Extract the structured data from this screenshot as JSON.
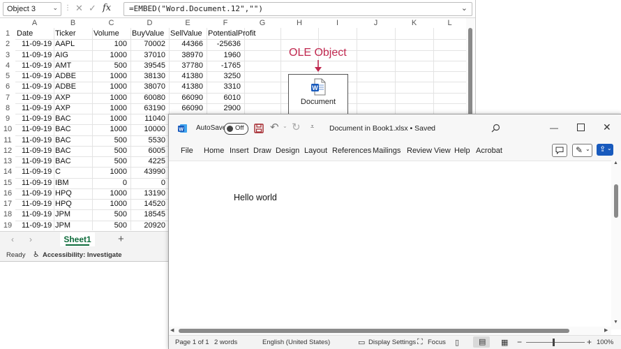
{
  "excel": {
    "name_box": "Object 3",
    "formula": "=EMBED(\"Word.Document.12\",\"\")",
    "columns": [
      "A",
      "B",
      "C",
      "D",
      "E",
      "F",
      "G",
      "H",
      "I",
      "J",
      "K",
      "L"
    ],
    "rows": [
      {
        "n": "1",
        "a": "Date",
        "b": "Ticker",
        "c": "Volume",
        "d": "BuyValue",
        "e": "SellValue",
        "f": "PotentialProfit",
        "header": true
      },
      {
        "n": "2",
        "a": "11-09-19",
        "b": "AAPL",
        "c": "100",
        "d": "70002",
        "e": "44366",
        "f": "-25636"
      },
      {
        "n": "3",
        "a": "11-09-19",
        "b": "AIG",
        "c": "1000",
        "d": "37010",
        "e": "38970",
        "f": "1960"
      },
      {
        "n": "4",
        "a": "11-09-19",
        "b": "AMT",
        "c": "500",
        "d": "39545",
        "e": "37780",
        "f": "-1765"
      },
      {
        "n": "5",
        "a": "11-09-19",
        "b": "ADBE",
        "c": "1000",
        "d": "38130",
        "e": "41380",
        "f": "3250"
      },
      {
        "n": "6",
        "a": "11-09-19",
        "b": "ADBE",
        "c": "1000",
        "d": "38070",
        "e": "41380",
        "f": "3310"
      },
      {
        "n": "7",
        "a": "11-09-19",
        "b": "AXP",
        "c": "1000",
        "d": "60080",
        "e": "66090",
        "f": "6010"
      },
      {
        "n": "8",
        "a": "11-09-19",
        "b": "AXP",
        "c": "1000",
        "d": "63190",
        "e": "66090",
        "f": "2900"
      },
      {
        "n": "9",
        "a": "11-09-19",
        "b": "BAC",
        "c": "1000",
        "d": "11040",
        "e": "",
        "f": ""
      },
      {
        "n": "10",
        "a": "11-09-19",
        "b": "BAC",
        "c": "1000",
        "d": "10000",
        "e": "",
        "f": ""
      },
      {
        "n": "11",
        "a": "11-09-19",
        "b": "BAC",
        "c": "500",
        "d": "5530",
        "e": "",
        "f": ""
      },
      {
        "n": "12",
        "a": "11-09-19",
        "b": "BAC",
        "c": "500",
        "d": "6005",
        "e": "",
        "f": ""
      },
      {
        "n": "13",
        "a": "11-09-19",
        "b": "BAC",
        "c": "500",
        "d": "4225",
        "e": "",
        "f": ""
      },
      {
        "n": "14",
        "a": "11-09-19",
        "b": "C",
        "c": "1000",
        "d": "43990",
        "e": "",
        "f": ""
      },
      {
        "n": "15",
        "a": "11-09-19",
        "b": "IBM",
        "c": "0",
        "d": "0",
        "e": "",
        "f": ""
      },
      {
        "n": "16",
        "a": "11-09-19",
        "b": "HPQ",
        "c": "1000",
        "d": "13190",
        "e": "",
        "f": ""
      },
      {
        "n": "17",
        "a": "11-09-19",
        "b": "HPQ",
        "c": "1000",
        "d": "14520",
        "e": "",
        "f": ""
      },
      {
        "n": "18",
        "a": "11-09-19",
        "b": "JPM",
        "c": "500",
        "d": "18545",
        "e": "",
        "f": ""
      },
      {
        "n": "19",
        "a": "11-09-19",
        "b": "JPM",
        "c": "500",
        "d": "20920",
        "e": "",
        "f": ""
      }
    ],
    "sheet_tab": "Sheet1",
    "status_ready": "Ready",
    "status_accessibility": "Accessibility: Investigate"
  },
  "ole": {
    "annotation": "OLE Object",
    "label": "Document",
    "accent": "#c0284f"
  },
  "word": {
    "autosave_label": "AutoSave",
    "autosave_state": "Off",
    "title": "Document in Book1.xlsx • Saved",
    "menu": [
      "File",
      "Home",
      "Insert",
      "Draw",
      "Design",
      "Layout",
      "References",
      "Mailings",
      "Review",
      "View",
      "Help",
      "Acrobat"
    ],
    "body_text": "Hello world",
    "status": {
      "page": "Page 1 of 1",
      "words": "2 words",
      "language": "English (United States)",
      "display": "Display Settings",
      "focus": "Focus",
      "zoom": "100%"
    },
    "brand_color": "#185abd"
  }
}
